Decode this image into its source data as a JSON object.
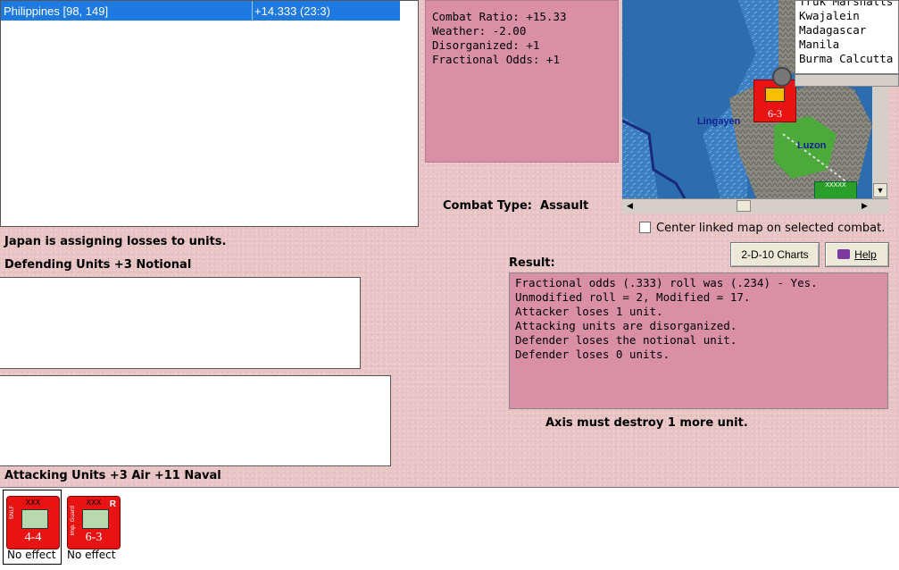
{
  "battle_list": {
    "row_name": "Philippines [98, 149]",
    "row_value": "+14.333 (23:3)"
  },
  "modifiers": [
    "Combat Ratio: +15.33",
    "Weather: -2.00",
    "Disorganized: +1",
    "Fractional Odds: +1"
  ],
  "map": {
    "labels": [
      "Lingayen",
      "Luzon"
    ],
    "unit_strength": "6-3",
    "unit_size": "XXXXX"
  },
  "city_list": [
    "Truk Marshalls",
    "Kwajalein",
    "Madagascar",
    "Manila",
    "Burma Calcutta"
  ],
  "combat_type_label": "Combat Type:",
  "combat_type_value": "Assault",
  "center_linked": "Center linked map on selected combat.",
  "buttons": {
    "charts": "2-D-10 Charts",
    "help": "Help"
  },
  "assign_msg": "Japan is assigning losses to units.",
  "defending_label": "Defending Units +3 Notional",
  "result_label": "Result:",
  "result_lines": [
    "Fractional odds (.333) roll was (.234)  - Yes.",
    "Unmodified roll = 2, Modified = 17.",
    "Attacker loses 1 unit.",
    "Attacking units are disorganized.",
    "Defender loses the notional unit.",
    "Defender loses 0 units."
  ],
  "axis_msg": "Axis must destroy 1 more unit.",
  "attacking_label": "Attacking Units +3 Air +11 Naval",
  "units": [
    {
      "size": "XXX",
      "strength": "4-4",
      "side": "SNLF",
      "effect": "No effect",
      "flag": ""
    },
    {
      "size": "XXX",
      "strength": "6-3",
      "side": "Imp. Guard",
      "effect": "No effect",
      "flag": "R"
    }
  ],
  "colors": {
    "pink_box": "#d98fa6",
    "selection": "#1e7ae0",
    "unit_red": "#e81414"
  }
}
